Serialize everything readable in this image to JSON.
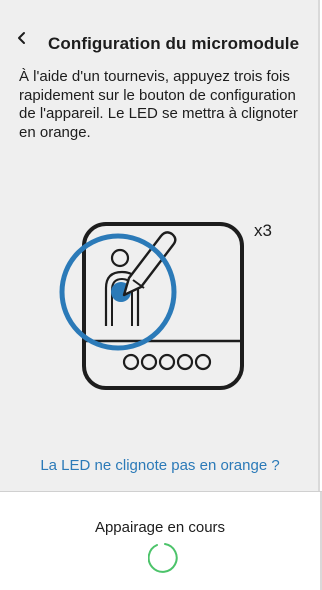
{
  "header": {
    "back_icon": "chevron-left-icon",
    "title": "Configuration du micromodule"
  },
  "main": {
    "instructions": "À l'aide d'un tournevis, appuyez trois fois rapidement sur le bouton de configuration de l'appareil. Le LED se mettra à clignoter en orange.",
    "illustration": {
      "press_count": "x3",
      "accent_color": "#2b7ab8"
    },
    "help_link": "La LED ne clignote pas en orange ?"
  },
  "footer": {
    "status_text": "Appairage en cours",
    "spinner_icon": "loading-spinner-icon",
    "spinner_color": "#4cc36a"
  }
}
